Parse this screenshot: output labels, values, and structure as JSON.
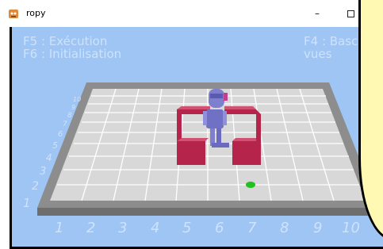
{
  "window": {
    "title": "ropy"
  },
  "hud": {
    "line1_left": "F5 : Exécution",
    "line2_left": "F6 : Initialisation",
    "line1_right": "F4 : Basc",
    "line2_right": "vues"
  },
  "axes": {
    "x_ticks": [
      "1",
      "2",
      "3",
      "4",
      "5",
      "6",
      "7",
      "8",
      "9",
      "10"
    ],
    "y_ticks": [
      "1",
      "2",
      "3",
      "4",
      "5",
      "6",
      "7",
      "8",
      "9",
      "10"
    ]
  },
  "icons": {
    "app": "ropy-app-icon",
    "minimize": "minimize-icon",
    "maximize": "maximize-icon"
  },
  "colors": {
    "sky": "#9ec5f4",
    "board": "#d8d8d8",
    "walls": "#b5244b",
    "robot": "#7f7fd0",
    "goal": "#22c020",
    "note": "#fff9b3"
  }
}
